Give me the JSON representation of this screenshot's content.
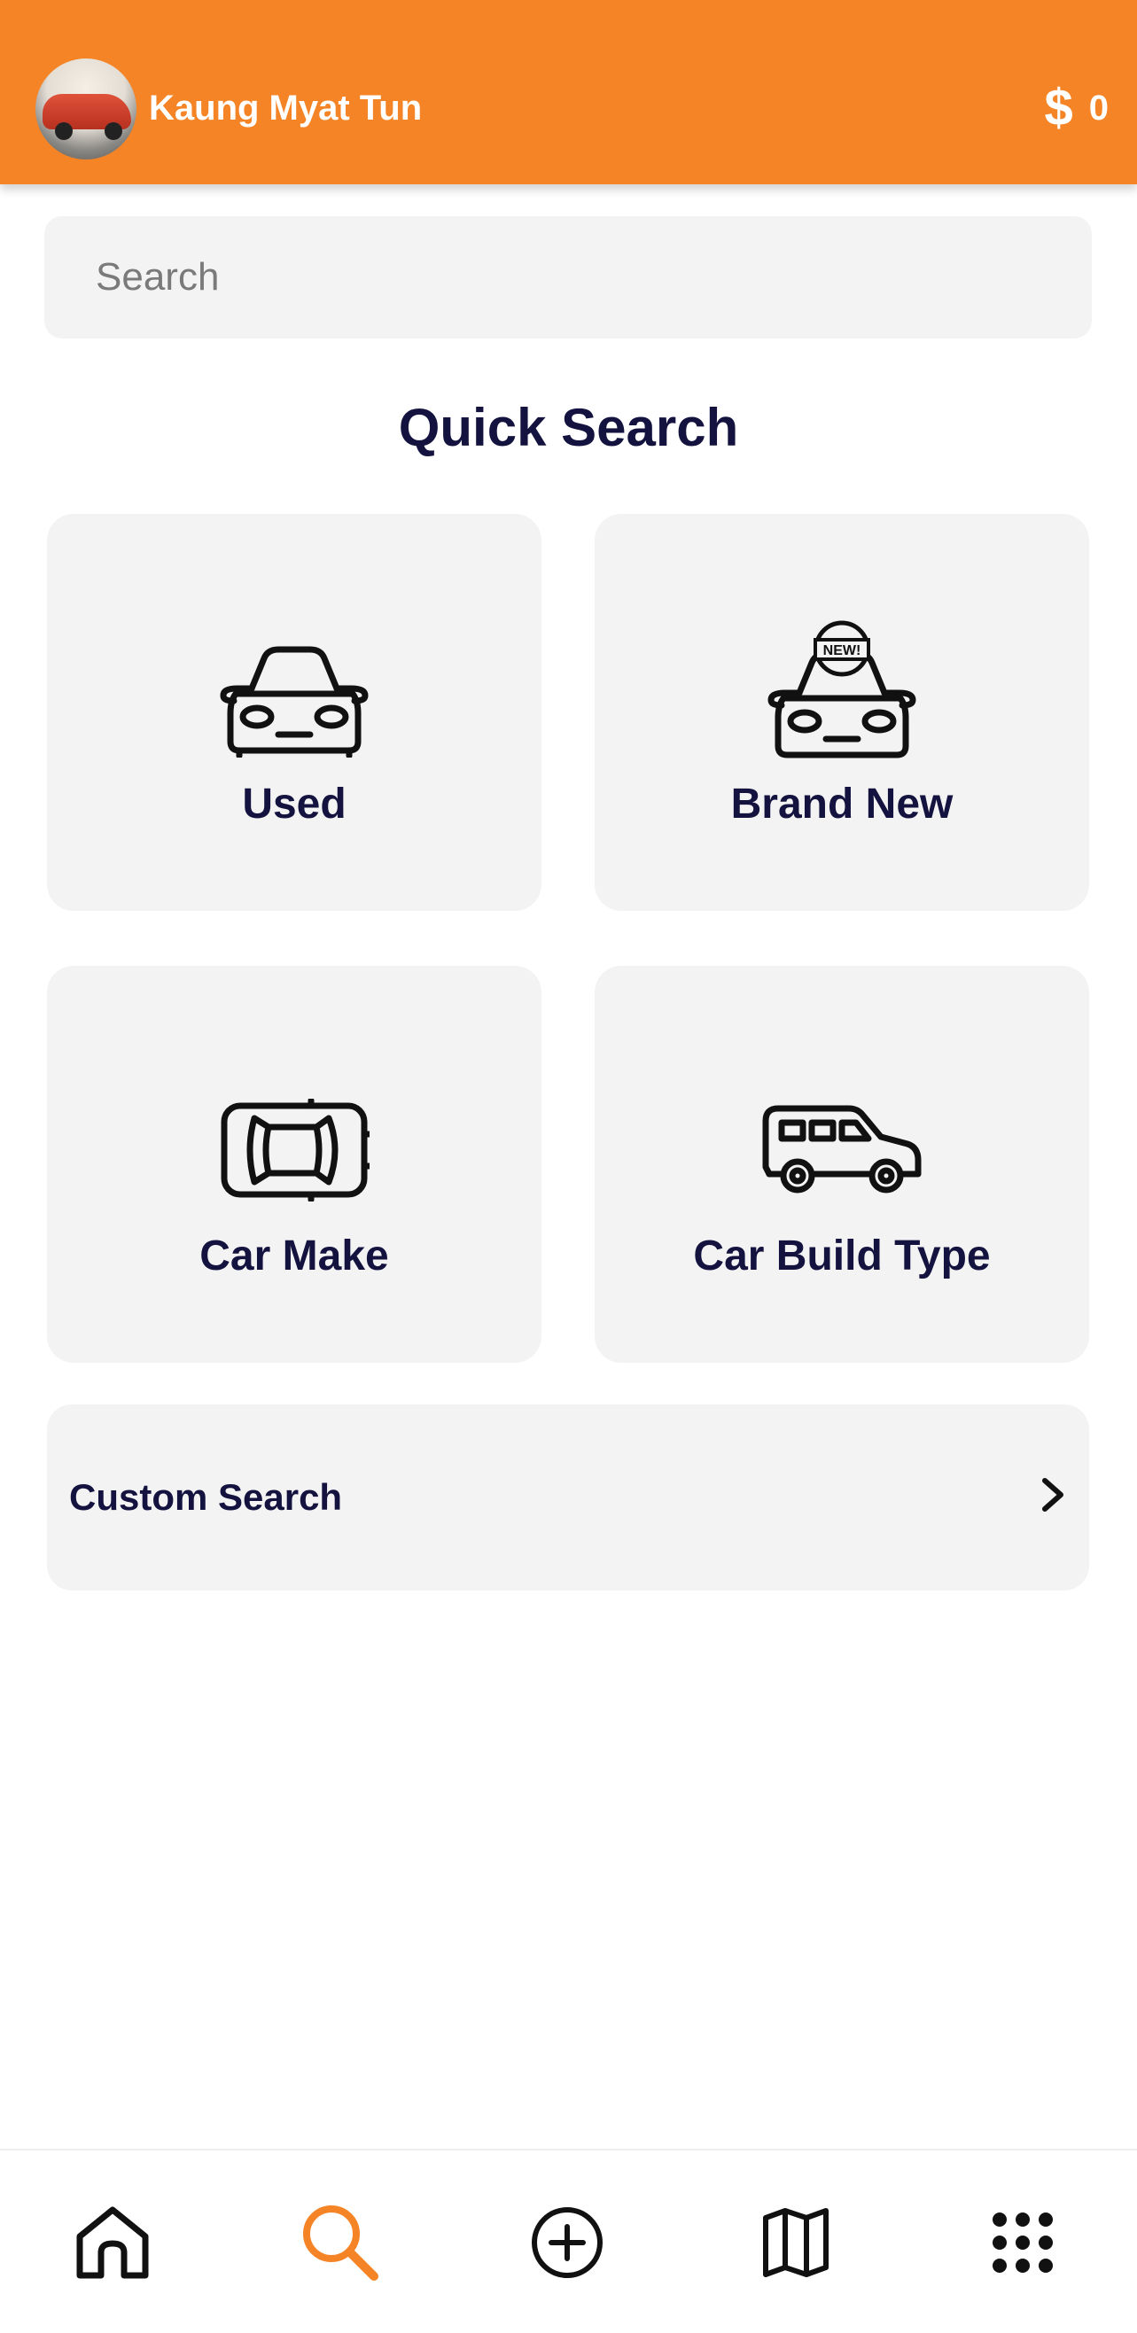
{
  "header": {
    "username": "Kaung Myat Tun",
    "currency_icon": "$",
    "balance": "0",
    "bg_color": "#F58426"
  },
  "search": {
    "placeholder": "Search"
  },
  "quick_search": {
    "title": "Quick Search",
    "cards": [
      {
        "label": "Used",
        "icon": "car-front-icon"
      },
      {
        "label": "Brand New",
        "icon": "new-car-icon",
        "badge": "NEW!"
      },
      {
        "label": "Car Make",
        "icon": "car-top-view-icon"
      },
      {
        "label": "Car Build Type",
        "icon": "suv-icon"
      }
    ]
  },
  "custom_search": {
    "label": "Custom Search"
  },
  "bottom_nav": {
    "items": [
      {
        "name": "home",
        "icon": "home-icon",
        "active": false
      },
      {
        "name": "search",
        "icon": "search-icon",
        "active": true
      },
      {
        "name": "add",
        "icon": "plus-circle-icon",
        "active": false
      },
      {
        "name": "map",
        "icon": "map-icon",
        "active": false
      },
      {
        "name": "more",
        "icon": "grid-icon",
        "active": false
      }
    ],
    "active_color": "#F58426",
    "inactive_color": "#111111"
  },
  "colors": {
    "text_dark": "#14133F",
    "card_bg": "#F3F3F3"
  }
}
